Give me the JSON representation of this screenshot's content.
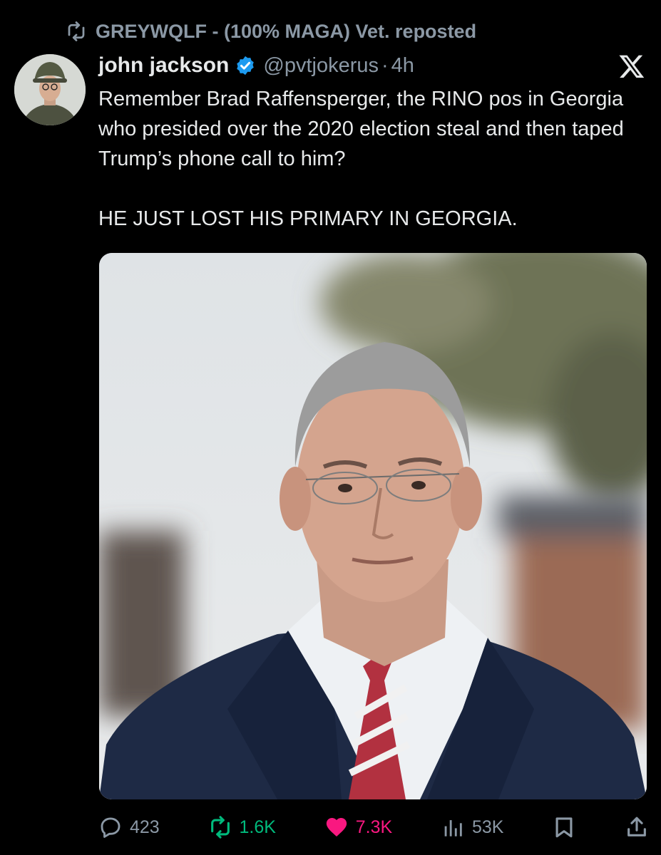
{
  "repost": {
    "text": "GREYWQLF - (100% MAGA) Vet. reposted",
    "icon": "retweet-icon"
  },
  "tweet": {
    "author_name": "john jackson",
    "handle": "@pvtjokerus",
    "separator": "·",
    "time": "4h",
    "verified": true,
    "text_p1": "Remember Brad Raffensperger, the RINO pos in Georgia who presided over the 2020 election steal and then taped Trump’s phone call to him?",
    "text_p2": "HE JUST LOST HIS PRIMARY IN GEORGIA."
  },
  "actions": {
    "replies": "423",
    "reposts": "1.6K",
    "likes": "7.3K",
    "views": "53K"
  },
  "colors": {
    "background": "#000000",
    "primary_text": "#e7e9ea",
    "secondary_text": "#8b98a5",
    "verified_blue": "#1d9bf0",
    "repost_green": "#00ba7c",
    "like_pink": "#f91880"
  }
}
